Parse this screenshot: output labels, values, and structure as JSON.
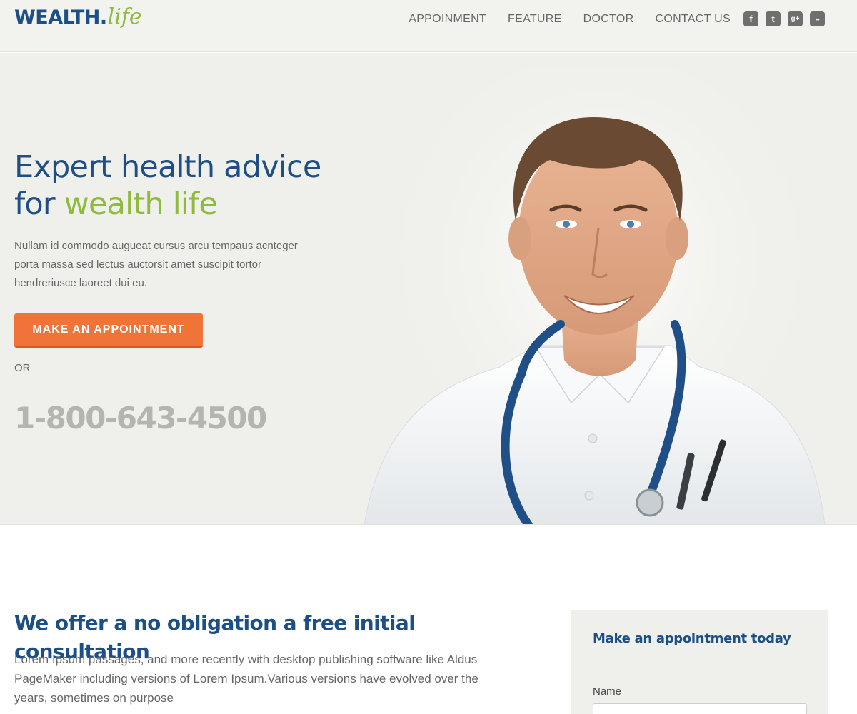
{
  "header": {
    "logo_main": "WEALTH.",
    "logo_script": "life",
    "nav": [
      {
        "label": "APPOINMENT"
      },
      {
        "label": "FEATURE"
      },
      {
        "label": "DOCTOR"
      },
      {
        "label": "CONTACT US"
      }
    ],
    "social": [
      {
        "icon": "facebook-icon",
        "glyph": "f"
      },
      {
        "icon": "twitter-icon",
        "glyph": "t"
      },
      {
        "icon": "google-plus-icon",
        "glyph": "g+"
      },
      {
        "icon": "flickr-icon",
        "glyph": "••"
      }
    ]
  },
  "hero": {
    "title_line1": "Expert health advice",
    "title_for": "for ",
    "title_accent": "wealth life",
    "text": "Nullam id commodo augueat cursus arcu tempaus acnteger porta massa sed lectus auctorsit amet suscipit tortor hendreriusce laoreet dui eu.",
    "cta_label": "MAKE AN APPOINTMENT",
    "or_label": "OR",
    "phone": "1-800-643-4500"
  },
  "consultation": {
    "title": "We offer a no obligation a free initial consultation",
    "text": "Lorem Ipsum passages, and more recently with desktop publishing software like Aldus PageMaker including versions of Lorem Ipsum.Various versions have evolved over the years, sometimes on purpose"
  },
  "appointment_form": {
    "title": "Make an appointment today",
    "name_label": "Name",
    "name_value": ""
  },
  "colors": {
    "brand_blue": "#1d4f86",
    "brand_green": "#8fba3c",
    "cta_orange": "#f0733a",
    "hero_bg": "#efefeb"
  }
}
